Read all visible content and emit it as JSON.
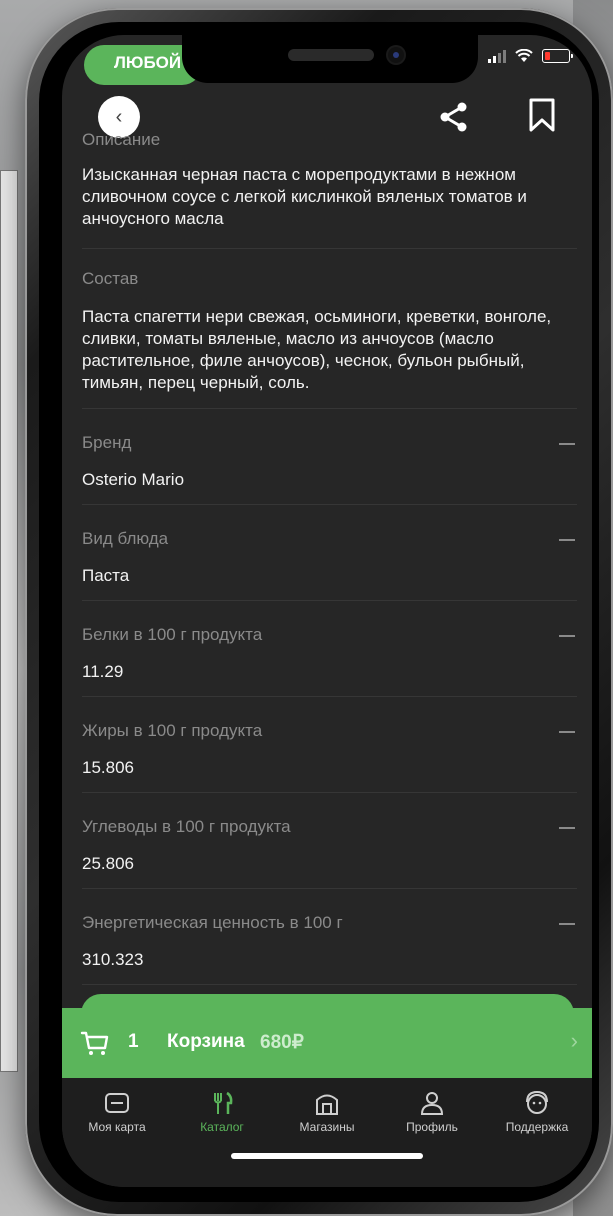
{
  "status_bar": {
    "badge": "ЛЮБОЙ"
  },
  "top_bar": {
    "back_icon": "chevron-left-icon",
    "share_icon": "share-icon",
    "bookmark_icon": "bookmark-icon"
  },
  "description": {
    "label": "Описание",
    "text": "Изысканная черная паста с морепродуктами в нежном сливочном соусе с легкой кислинкой вяленых томатов и анчоусного масла"
  },
  "composition": {
    "label": "Состав",
    "text": "Паста спагетти нери свежая, осьминоги, креветки, вонголе, сливки, томаты вяленые, масло из анчоусов (масло растительное, филе анчоусов), чеснок, бульон рыбный, тимьян, перец черный, соль."
  },
  "attributes": [
    {
      "label": "Бренд",
      "value": "Osterio Mario"
    },
    {
      "label": "Вид блюда",
      "value": "Паста"
    },
    {
      "label": "Белки в 100 г продукта",
      "value": "11.29"
    },
    {
      "label": "Жиры в 100 г продукта",
      "value": "15.806"
    },
    {
      "label": "Углеводы в 100 г продукта",
      "value": "25.806"
    },
    {
      "label": "Энергетическая ценность в 100 г",
      "value": "310.323"
    }
  ],
  "cart": {
    "count": "1",
    "label": "Корзина",
    "price": "680₽"
  },
  "tabs": [
    {
      "label": "Моя карта",
      "icon": "card-icon",
      "active": false
    },
    {
      "label": "Каталог",
      "icon": "fork-knife-icon",
      "active": true
    },
    {
      "label": "Магазины",
      "icon": "store-icon",
      "active": false
    },
    {
      "label": "Профиль",
      "icon": "user-icon",
      "active": false
    },
    {
      "label": "Поддержка",
      "icon": "support-icon",
      "active": false
    }
  ],
  "colors": {
    "accent": "#5bb55b",
    "background": "#262626",
    "tabbar": "#1e1e1e"
  }
}
